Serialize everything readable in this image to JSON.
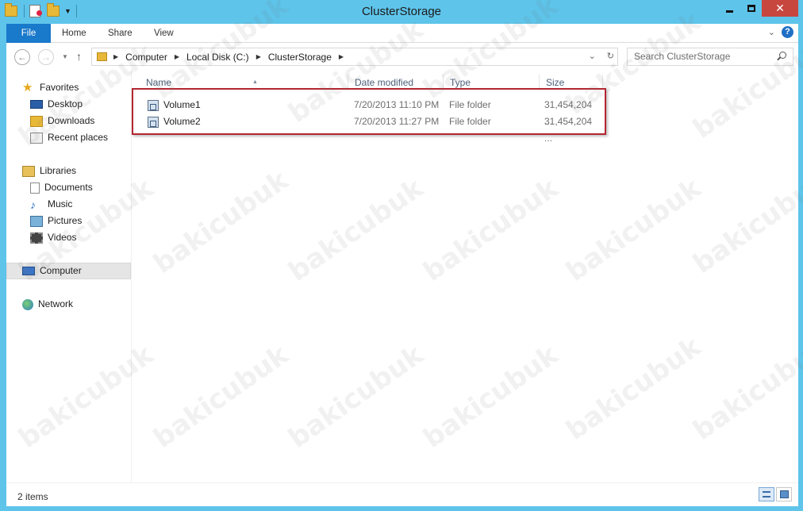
{
  "window": {
    "title": "ClusterStorage"
  },
  "ribbon": {
    "tabs": [
      {
        "label": "File"
      },
      {
        "label": "Home"
      },
      {
        "label": "Share"
      },
      {
        "label": "View"
      }
    ],
    "help_label": "?"
  },
  "address": {
    "breadcrumbs": [
      "Computer",
      "Local Disk (C:)",
      "ClusterStorage"
    ],
    "search_placeholder": "Search ClusterStorage"
  },
  "navigation": {
    "favorites_label": "Favorites",
    "favorites": [
      "Desktop",
      "Downloads",
      "Recent places"
    ],
    "libraries_label": "Libraries",
    "libraries": [
      "Documents",
      "Music",
      "Pictures",
      "Videos"
    ],
    "computer_label": "Computer",
    "network_label": "Network"
  },
  "columns": {
    "name": "Name",
    "date": "Date modified",
    "type": "Type",
    "size": "Size"
  },
  "files": [
    {
      "name": "Volume1",
      "date": "7/20/2013 11:10 PM",
      "type": "File folder",
      "size": "31,454,204 ..."
    },
    {
      "name": "Volume2",
      "date": "7/20/2013 11:27 PM",
      "type": "File folder",
      "size": "31,454,204 ..."
    }
  ],
  "status": {
    "item_count": "2 items"
  },
  "colors": {
    "frame": "#5ec4ea",
    "file_tab": "#1979ca",
    "highlight": "#b32630"
  },
  "watermark": "bakicubuk"
}
